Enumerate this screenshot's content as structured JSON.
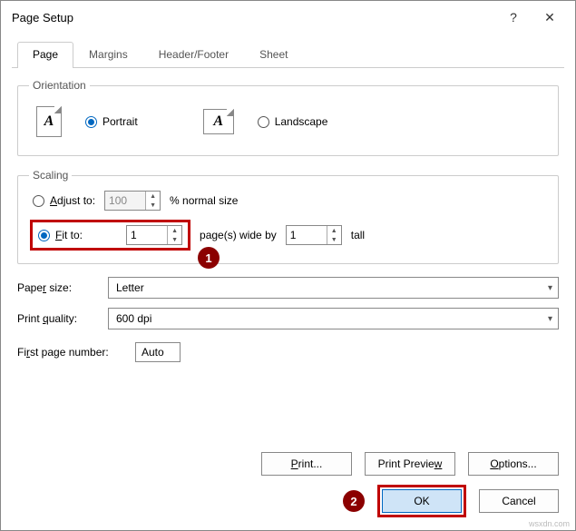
{
  "title": "Page Setup",
  "help": "?",
  "close": "✕",
  "tabs": {
    "page": "Page",
    "margins": "Margins",
    "headerfooter": "Header/Footer",
    "sheet": "Sheet"
  },
  "orientation": {
    "legend": "Orientation",
    "portrait": "Portrait",
    "landscape": "Landscape",
    "iconA": "A"
  },
  "scaling": {
    "legend": "Scaling",
    "adjust_label": "Adjust to:",
    "adjust_value": "100",
    "adjust_suffix": "% normal size",
    "fit_label": "Fit to:",
    "fit_wide": "1",
    "fit_mid": "page(s) wide by",
    "fit_tall_val": "1",
    "fit_tall_suffix": "tall"
  },
  "paper": {
    "label": "Paper size:",
    "value": "Letter"
  },
  "quality": {
    "label": "Print quality:",
    "value": "600 dpi"
  },
  "firstpage": {
    "label": "First page number:",
    "value": "Auto"
  },
  "buttons": {
    "print": "Print...",
    "preview": "Print Preview",
    "options": "Options...",
    "ok": "OK",
    "cancel": "Cancel"
  },
  "callouts": {
    "one": "1",
    "two": "2"
  },
  "watermark": "wsxdn.com"
}
